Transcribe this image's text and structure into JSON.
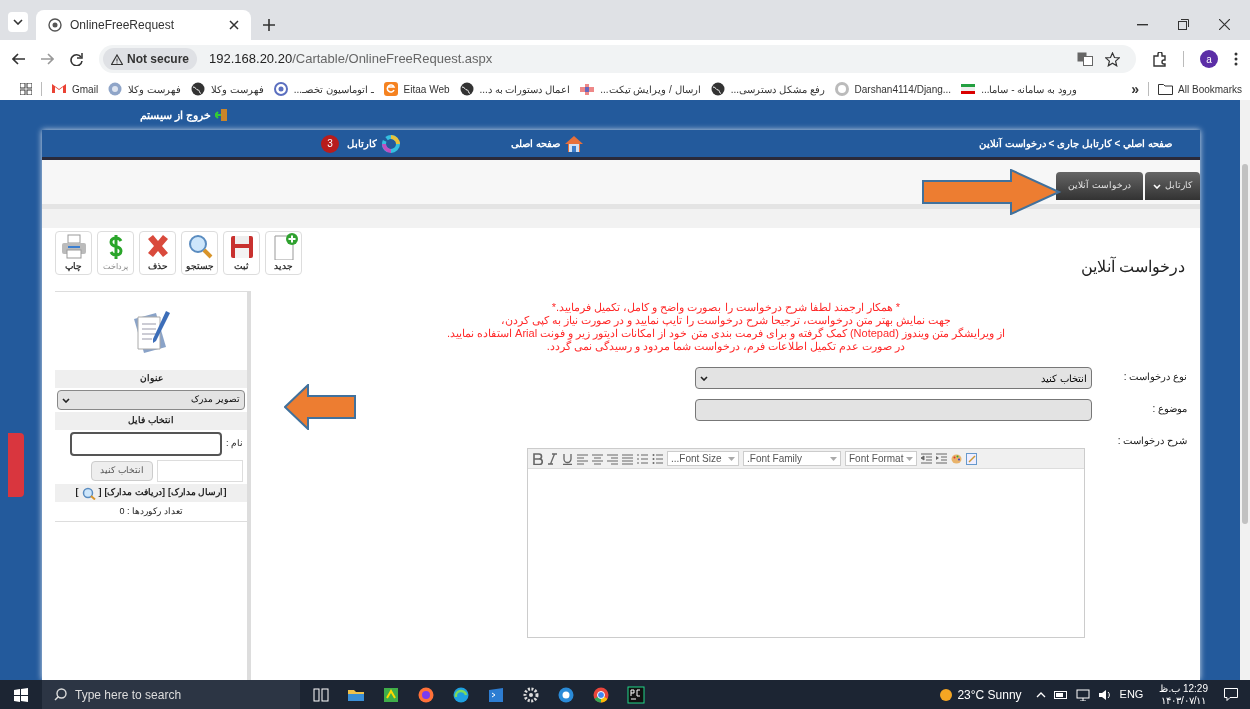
{
  "browser": {
    "tab_title": "OnlineFreeRequest",
    "security": "Not secure",
    "url_host": "192.168.20.20",
    "url_path": "/Cartable/OnlineFreeRequest.aspx",
    "profile": "a",
    "pinned_bookmark": {
      "kind": "gmail",
      "label": "Gmail"
    },
    "seal_bookmark": {
      "kind": "seal",
      "label": "فهرست وکلا"
    },
    "bookmarks": [
      {
        "kind": "flag",
        "label": "ورود به سامانه - ساما..."
      },
      {
        "kind": "github",
        "label": "Darshan4114/Djang..."
      },
      {
        "kind": "globe",
        "label": "رفع مشکل دسترسی..."
      },
      {
        "kind": "puzzle",
        "label": "ارسال / ویرایش تیکت..."
      },
      {
        "kind": "globe",
        "label": "اعمال دستورات به د..."
      },
      {
        "kind": "eitaa",
        "label": "Eitaa Web"
      },
      {
        "kind": "ring",
        "label": "ـ اتوماسیون تخصـ..."
      },
      {
        "kind": "globe",
        "label": "فهرست وکلا"
      }
    ],
    "more": "»",
    "all_bookmarks": "All Bookmarks"
  },
  "page": {
    "logout": "خروج از سیستم",
    "breadcrumb": "صفحه اصلي > کارتابل جاری > درخواست آنلاین",
    "nav": [
      {
        "kind": "home",
        "label": "صفحه اصلی"
      },
      {
        "kind": "cartable",
        "label": "کارتابل",
        "badge": "3"
      }
    ],
    "tabs": [
      {
        "label": "کارتابل",
        "kind": "dropdown"
      },
      {
        "label": "درخواست آنلاین",
        "kind": "plain"
      }
    ],
    "toolbar": [
      {
        "kind": "new",
        "label": "جدید",
        "disabled": false
      },
      {
        "kind": "save",
        "label": "ثبت",
        "disabled": false
      },
      {
        "kind": "search",
        "label": "جستجو",
        "disabled": false
      },
      {
        "kind": "delete",
        "label": "حذف",
        "disabled": false
      },
      {
        "kind": "pay",
        "label": "پرداخت",
        "disabled": true
      },
      {
        "kind": "print",
        "label": "چاپ",
        "disabled": false
      }
    ],
    "heading": "درخواست آنلاین",
    "notice": [
      "* همکار ارجمند لطفا شرح درخواست را بصورت واضح و کامل، تکمیل فرمایید.*",
      "جهت نمایش بهتر متن درخواست، ترجیحا شرح درخواست را تایپ نمایید و در صورت نیاز به کپی کردن،",
      "از ویرایشگر متن ویندوز (Notepad) کمک گرفته و برای فرمت بندی متن خود از امکانات ادیتور زیر و فونت Arial استفاده نمایید.",
      "در صورت عدم تکمیل اطلاعات فرم، درخواست شما مردود و رسیدگی نمی گردد."
    ],
    "form": {
      "type_label": "نوع درخواست :",
      "type_value": "انتخاب کنید",
      "subject_label": "موضوع :",
      "description_label": "شرح درخواست :",
      "font_size_select": "...Font Size",
      "font_family_select": ".Font Family",
      "font_format_select": "Font Format"
    },
    "attachments": {
      "title": "عنوان",
      "doc_type": "تصویر مدرک",
      "choose_file": "انتخاب فایل",
      "name_label": "نام :",
      "browse": "انتخاب کنید",
      "send": "[ارسال مدارک]",
      "receive": "[دریافت مدارک]",
      "view_open": "[",
      "view_close": "]",
      "records": "تعداد رکوردها : 0"
    }
  },
  "taskbar": {
    "search_placeholder": "Type here to search",
    "weather": "23°C Sunny",
    "lang": "ENG",
    "time": "12:29 ب.ظ",
    "date": "۱۴۰۳/۰۷/۱۱"
  }
}
